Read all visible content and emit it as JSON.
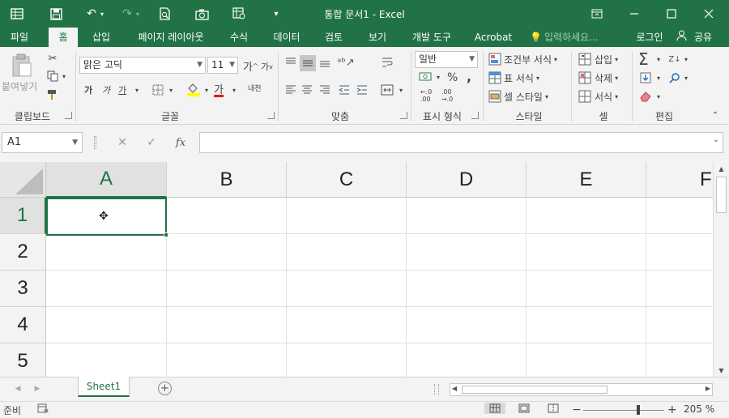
{
  "window": {
    "title": "통합 문서1 - Excel",
    "accent_color": "#217346",
    "qat_icons": [
      "save-icon",
      "undo-icon",
      "redo-icon",
      "print-preview-icon",
      "camera-icon",
      "sheet-settings-icon",
      "customize-qat-icon"
    ],
    "controls": [
      "ribbon-display-icon",
      "minimize-icon",
      "maximize-icon",
      "close-icon"
    ]
  },
  "ribbon_tabs": [
    "파일",
    "홈",
    "삽입",
    "페이지 레이아웃",
    "수식",
    "데이터",
    "검토",
    "보기",
    "개발 도구",
    "Acrobat"
  ],
  "active_tab": "홈",
  "tell_me": "입력하세요...",
  "login": "로그인",
  "share": "공유",
  "groups": {
    "clipboard": {
      "label": "클립보드",
      "paste": "붙여넣기"
    },
    "font": {
      "label": "글꼴",
      "font_name": "맑은 고딕",
      "font_size": "11",
      "grow": "가",
      "shrink": "가",
      "bold": "가",
      "italic": "가",
      "underline": "가",
      "font_color_label": "가",
      "phonetic": "내천"
    },
    "alignment": {
      "label": "맞춤"
    },
    "number": {
      "label": "표시 형식",
      "format": "일반",
      "percent": "%",
      "comma": ",",
      "inc_dec": "←.0\n.00",
      "dec_dec": ".00\n→.0"
    },
    "styles": {
      "label": "스타일",
      "conditional": "조건부 서식",
      "table": "표 서식",
      "cell_styles": "셀 스타일"
    },
    "cells": {
      "label": "셀",
      "insert": "삽입",
      "delete": "삭제",
      "format": "서식"
    },
    "editing": {
      "label": "편집",
      "sum": "Σ"
    }
  },
  "formula_bar": {
    "name_box": "A1",
    "cancel": "✕",
    "enter": "✓",
    "fx": "fx",
    "content": ""
  },
  "grid": {
    "columns": [
      "A",
      "B",
      "C",
      "D",
      "E",
      "F"
    ],
    "rows": [
      "1",
      "2",
      "3",
      "4",
      "5"
    ],
    "active_cell": "A1"
  },
  "sheet_tabs": [
    "Sheet1"
  ],
  "add_sheet": "+",
  "status": {
    "ready": "준비",
    "zoom": "205 %",
    "zoom_level": 2.05
  }
}
